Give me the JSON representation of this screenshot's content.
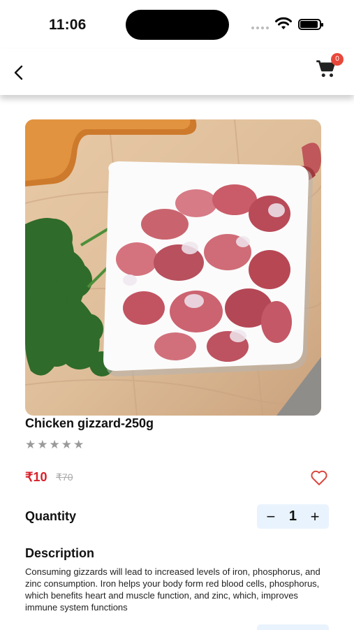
{
  "status_bar": {
    "time": "11:06"
  },
  "header": {
    "cart_count": "0"
  },
  "product": {
    "title": "Chicken gizzard-250g",
    "stars": [
      "★",
      "★",
      "★",
      "★",
      "★"
    ],
    "price": "₹10",
    "mrp": "₹70",
    "quantity_label": "Quantity",
    "quantity_value": "1",
    "decrement": "−",
    "increment": "+",
    "description_label": "Description",
    "description": "Consuming gizzards will lead to increased levels of iron, phosphorus, and zinc consumption. Iron helps your body form red blood cells, phosphorus, which benefits heart and muscle function, and zinc, which, improves immune system functions"
  },
  "colors": {
    "price": "#d8202a",
    "badge": "#e8483b",
    "stepper_bg": "#e9f3fd"
  }
}
